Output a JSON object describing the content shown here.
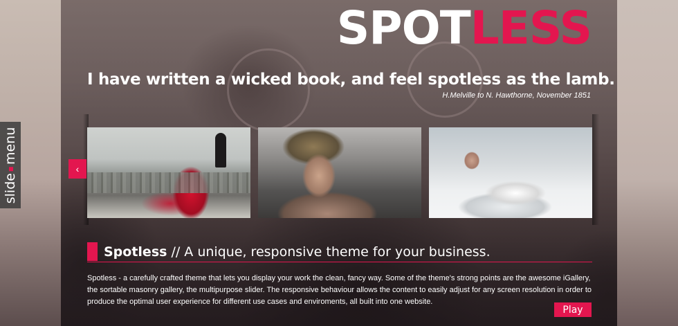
{
  "logo": {
    "part1": "SPOT",
    "part2": "LESS"
  },
  "hero": {
    "quote": "I have written a wicked book, and feel spotless as the lamb.",
    "attribution": "H.Melville to N. Hawthorne, November 1851"
  },
  "slide_menu": {
    "word1": "slide",
    "word2": "menu"
  },
  "gallery": {
    "prev_icon": "chevron-left-icon",
    "prev_glyph": "‹",
    "items": [
      {
        "alt": "woman in red dress over city"
      },
      {
        "alt": "woman with headdress portrait"
      },
      {
        "alt": "woman reclining in white fur"
      }
    ]
  },
  "intro": {
    "title_strong": "Spotless",
    "title_rest": "// A unique, responsive theme for your business.",
    "description": "Spotless - a carefully crafted theme that lets you display your work the clean, fancy way. Some of the theme's strong points are the awesome iGallery, the sortable masonry gallery, the multipurpose slider. The responsive behaviour allows the content to easily adjust for any screen resolution in order to produce the optimal user experience for different use cases and enviroments, all built into one website.",
    "play_label": "Play"
  },
  "colors": {
    "accent": "#e3164f"
  }
}
